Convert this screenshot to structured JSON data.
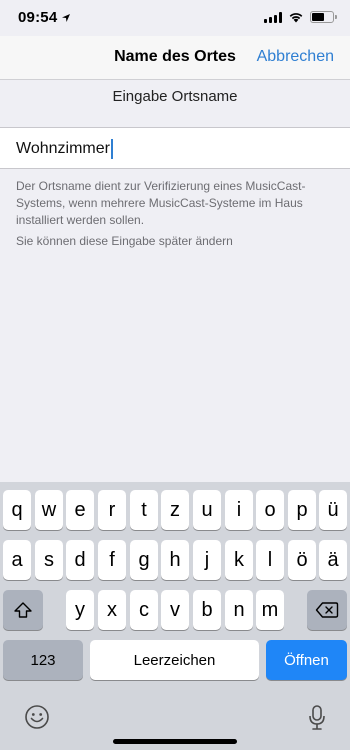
{
  "status": {
    "time": "09:54",
    "icons": [
      "location-arrow-icon",
      "cellular-signal-icon",
      "wifi-icon",
      "battery-icon"
    ]
  },
  "nav": {
    "title": "Name des Ortes",
    "cancel": "Abbrechen"
  },
  "form": {
    "section_title": "Eingabe Ortsname",
    "input_value": "Wohnzimmer",
    "description": "Der Ortsname dient zur Verifizierung eines MusicCast-Systems, wenn mehrere MusicCast-Systeme im Haus installiert werden sollen.",
    "note": "Sie können diese Eingabe später ändern"
  },
  "keyboard": {
    "row1": [
      "q",
      "w",
      "e",
      "r",
      "t",
      "z",
      "u",
      "i",
      "o",
      "p",
      "ü"
    ],
    "row2": [
      "a",
      "s",
      "d",
      "f",
      "g",
      "h",
      "j",
      "k",
      "l",
      "ö",
      "ä"
    ],
    "row3": [
      "y",
      "x",
      "c",
      "v",
      "b",
      "n",
      "m"
    ],
    "numbers_key": "123",
    "space_key": "Leerzeichen",
    "return_key": "Öffnen",
    "icons": [
      "shift-icon",
      "backspace-icon",
      "emoji-icon",
      "microphone-icon"
    ]
  },
  "colors": {
    "accent": "#2f7fd2",
    "return_key": "#1f86f7",
    "background": "#efeff4",
    "keyboard": "#d2d5db"
  }
}
